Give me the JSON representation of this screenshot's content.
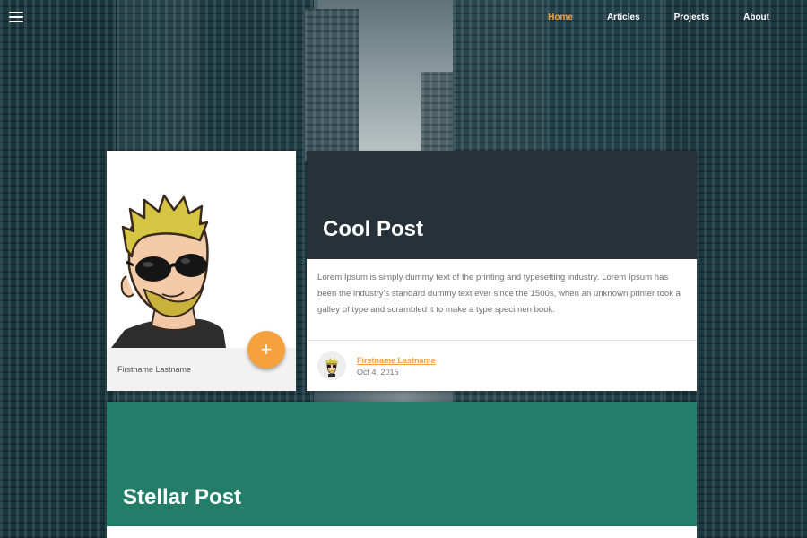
{
  "nav": {
    "menu_icon": "hamburger-menu-icon",
    "links": [
      {
        "label": "Home",
        "active": true
      },
      {
        "label": "Articles",
        "active": false
      },
      {
        "label": "Projects",
        "active": false
      },
      {
        "label": "About",
        "active": false
      }
    ]
  },
  "profile": {
    "name": "Firstname Lastname",
    "fab_label": "+",
    "fab_icon": "plus-icon"
  },
  "post": {
    "title": "Cool Post",
    "body": "Lorem Ipsum is simply dummy text of the printing and typesetting industry. Lorem Ipsum has been the industry's standard dummy text ever since the 1500s, when an unknown printer took a galley of type and scrambled it to make a type specimen book.",
    "author": "Firstname Lastname",
    "date": "Oct 4, 2015",
    "header_color": "#263238"
  },
  "second_post": {
    "title": "Stellar Post",
    "header_color": "#237d68"
  },
  "colors": {
    "accent": "#f4a13e"
  }
}
